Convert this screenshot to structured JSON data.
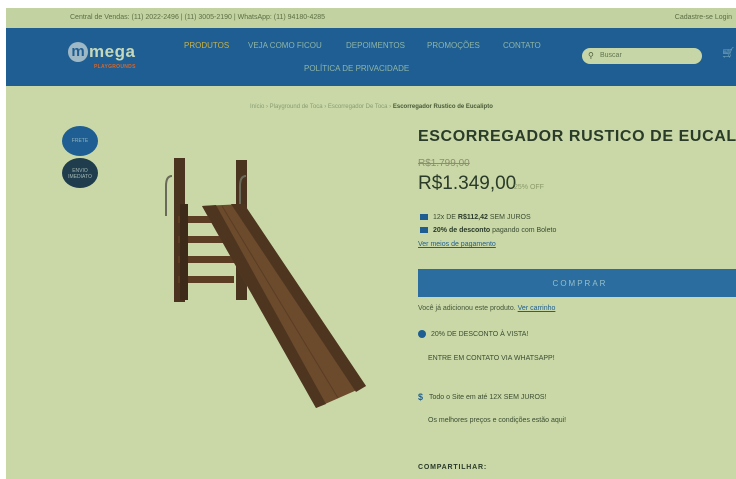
{
  "topbar": {
    "contact": "Central de Vendas: (11) 2022-2496 | (11) 3005-2190 | WhatsApp: (11) 94180-4285",
    "account": "Cadastre-se  Login"
  },
  "logo": {
    "letter": "m",
    "name": "mega",
    "tagline": "PLAYGROUNDS"
  },
  "nav": {
    "items": [
      "PRODUTOS",
      "VEJA COMO FICOU",
      "DEPOIMENTOS",
      "PROMOÇÕES",
      "CONTATO",
      "POLÍTICA DE PRIVACIDADE"
    ]
  },
  "search": {
    "placeholder": "Buscar"
  },
  "breadcrumb": {
    "path": "Início › Playground de Toca › Escorregador De Toca › ",
    "current": "Escorregador Rustico de Eucalipto"
  },
  "badges": {
    "shipping": "FRETE",
    "stock": "ENVIO IMEDIATO"
  },
  "product": {
    "title": "ESCORREGADOR RUSTICO DE EUCALIPTO",
    "old_price": "R$1.799,00",
    "price": "R$1.349,00",
    "discount": "25% OFF",
    "installments_prefix": "12x DE ",
    "installments_value": "R$112,42",
    "installments_suffix": " SEM JUROS",
    "boleto_bold": "20% de desconto",
    "boleto_rest": " pagando com Boleto",
    "payment_link": "Ver meios de pagamento",
    "buy_label": "COMPRAR",
    "added_text": "Você já adicionou este produto.",
    "cart_link": "Ver carrinho",
    "whatsapp_discount": "20% DE DESCONTO À VISTA!",
    "whatsapp_contact": "ENTRE EM CONTATO VIA WHATSAPP!",
    "site_installments": "Todo o Site em até 12X SEM JUROS!",
    "best_prices": "Os melhores preços e condições estão aqui!",
    "share_label": "COMPARTILHAR:"
  },
  "icons": {
    "search": "search-icon",
    "cart": "cart-icon",
    "card": "credit-card-icon",
    "barcode": "barcode-icon",
    "whatsapp": "whatsapp-icon",
    "dollar": "dollar-icon"
  }
}
